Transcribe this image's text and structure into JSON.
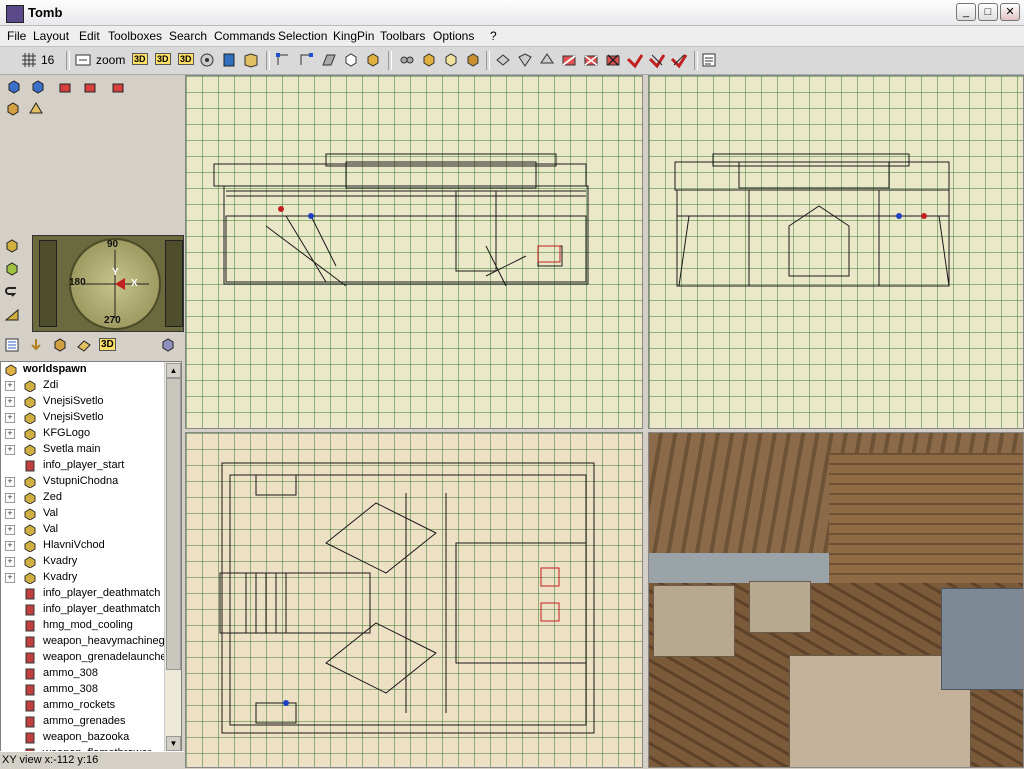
{
  "window": {
    "title": "Tomb",
    "minimize": "_",
    "maximize": "□",
    "close": "✕"
  },
  "menu": [
    "File",
    "Layout",
    "Edit",
    "Toolboxes",
    "Search",
    "Commands",
    "Selection",
    "KingPin",
    "Toolbars",
    "Options",
    "?"
  ],
  "toolbar": {
    "grid_size": "16",
    "zoom_label": "zoom",
    "btn_3d_a": "3D",
    "btn_3d_b": "3D",
    "btn_3d_c": "3D"
  },
  "compass": {
    "north": "90",
    "west": "180",
    "south": "270",
    "y_axis": "Y",
    "x_axis": "X"
  },
  "entity_tabs": {
    "label_3d": "3D"
  },
  "tree": {
    "root": "worldspawn",
    "items": [
      {
        "label": "Zdi",
        "type": "brush"
      },
      {
        "label": "VnejsiSvetlo",
        "type": "brush"
      },
      {
        "label": "VnejsiSvetlo",
        "type": "brush"
      },
      {
        "label": "KFGLogo",
        "type": "brush"
      },
      {
        "label": "Svetla main",
        "type": "brush"
      },
      {
        "label": "info_player_start",
        "type": "entity"
      },
      {
        "label": "VstupniChodna",
        "type": "brush"
      },
      {
        "label": "Zed",
        "type": "brush"
      },
      {
        "label": "Val",
        "type": "brush"
      },
      {
        "label": "Val",
        "type": "brush"
      },
      {
        "label": "HlavniVchod",
        "type": "brush"
      },
      {
        "label": "Kvadry",
        "type": "brush"
      },
      {
        "label": "Kvadry",
        "type": "brush"
      },
      {
        "label": "info_player_deathmatch",
        "type": "entity"
      },
      {
        "label": "info_player_deathmatch",
        "type": "entity"
      },
      {
        "label": "hmg_mod_cooling",
        "type": "entity"
      },
      {
        "label": "weapon_heavymachineg",
        "type": "entity"
      },
      {
        "label": "weapon_grenadelaunche",
        "type": "entity"
      },
      {
        "label": "ammo_308",
        "type": "entity"
      },
      {
        "label": "ammo_308",
        "type": "entity"
      },
      {
        "label": "ammo_rockets",
        "type": "entity"
      },
      {
        "label": "ammo_grenades",
        "type": "entity"
      },
      {
        "label": "weapon_bazooka",
        "type": "entity"
      },
      {
        "label": "weapon_flamethrower",
        "type": "entity"
      }
    ]
  },
  "status": {
    "view_coords": "XY view x:-112 y:16"
  },
  "colors": {
    "grid_bg": "#ebe8c9",
    "grid_line": "#3c8a3c",
    "brush_line": "#1a1a1a",
    "entity_red": "#c02020",
    "entity_blue": "#2040c0"
  }
}
